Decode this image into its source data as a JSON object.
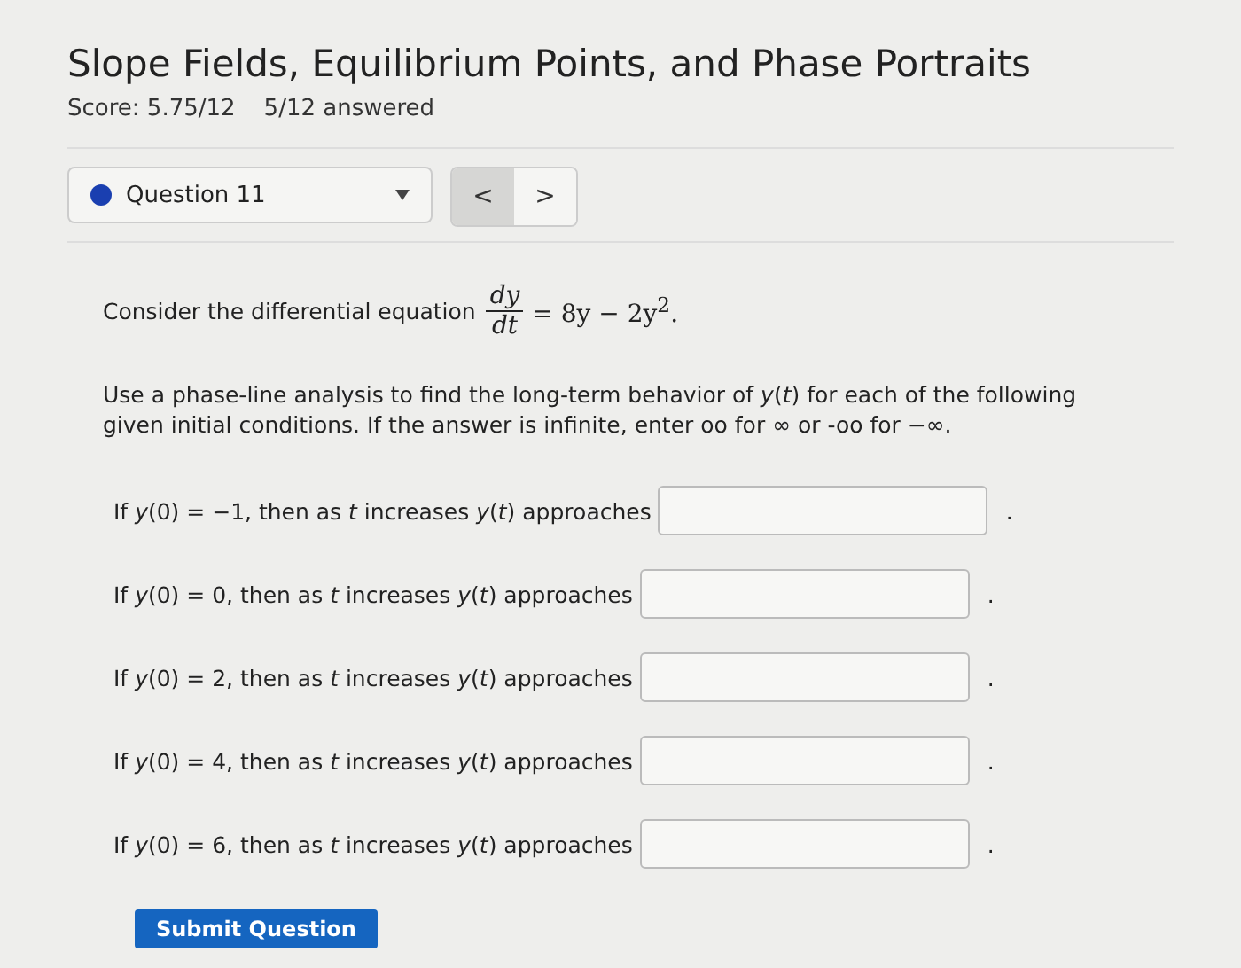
{
  "title": "Slope Fields, Equilibrium Points, and Phase Portraits",
  "score": "Score: 5.75/12",
  "answered": "5/12 answered",
  "question_select": {
    "label": "Question 11",
    "color": "#1a3fb0"
  },
  "nav_buttons": [
    {
      "label": "<",
      "pressed": true
    },
    {
      "label": ">",
      "pressed": false
    }
  ],
  "intro": "Consider the differential equation",
  "equation": {
    "numerator": "dy",
    "denominator": "dt",
    "rhs": "= 8y − 2y$^{2}$."
  },
  "instructions": "Use a phase-line analysis to find the long-term behavior of *y*(*t*) for each of the following given initial conditions. If the answer is infinite, enter oo for ∞ or -oo for −∞.",
  "rows": [
    {
      "prompt": "If *y*(0) = −1, then as *t* increases *y*(*t*) approaches",
      "suffix": "."
    },
    {
      "prompt": "If *y*(0) = 0, then as *t* increases *y*(*t*) approaches",
      "suffix": "."
    },
    {
      "prompt": "If *y*(0) = 2, then as *t* increases *y*(*t*) approaches",
      "suffix": "."
    },
    {
      "prompt": "If *y*(0) = 4, then as *t* increases *y*(*t*) approaches",
      "suffix": "."
    },
    {
      "prompt": "If *y*(0) = 6, then as *t* increases *y*(*t*) approaches",
      "suffix": "."
    }
  ],
  "submit": "Submit Question"
}
